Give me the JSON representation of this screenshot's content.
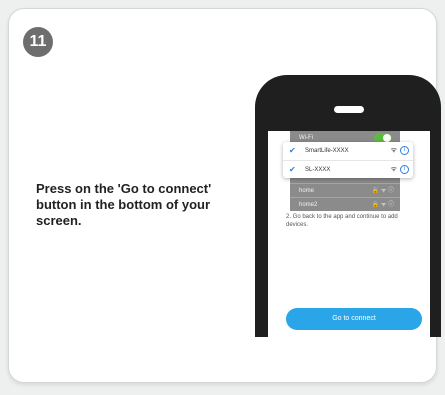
{
  "step": {
    "number": "11"
  },
  "instruction": "Press on the 'Go to connect' button in the bottom of your screen.",
  "phone_screen": {
    "settings_rows": [
      {
        "label": "Wi-Fi"
      },
      {
        "label": "home"
      },
      {
        "label": "home2"
      }
    ],
    "networks": [
      {
        "name": "SmartLife-XXXX",
        "selected": true
      },
      {
        "name": "SL-XXXX",
        "selected": true
      }
    ],
    "note": "2. Go back to the app and continue to add devices.",
    "connect_button_label": "Go to connect"
  },
  "colors": {
    "badge": "#6e6e6e",
    "accent_button": "#2aa6e8",
    "check": "#2f7ddc",
    "toggle_on": "#5dbb3f",
    "phone_body": "#1f1f1f"
  }
}
